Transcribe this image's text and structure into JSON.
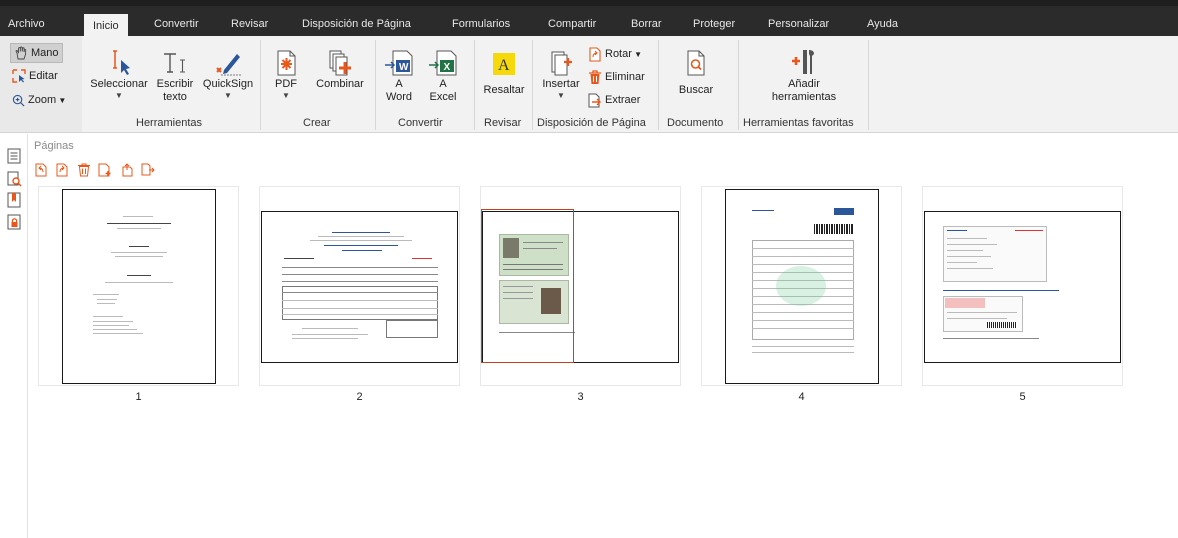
{
  "menu_tabs": [
    {
      "label": "Archivo"
    },
    {
      "label": "Inicio"
    },
    {
      "label": "Convertir"
    },
    {
      "label": "Revisar"
    },
    {
      "label": "Disposición de Página"
    },
    {
      "label": "Formularios"
    },
    {
      "label": "Compartir"
    },
    {
      "label": "Borrar"
    },
    {
      "label": "Proteger"
    },
    {
      "label": "Personalizar"
    },
    {
      "label": "Ayuda"
    }
  ],
  "active_tab": "Inicio",
  "mini_tools": {
    "mano": "Mano",
    "editar": "Editar",
    "zoom": "Zoom"
  },
  "herramientas": {
    "seleccionar": "Seleccionar",
    "escribir_1": "Escribir",
    "escribir_2": "texto",
    "quicksign": "QuickSign",
    "group": "Herramientas"
  },
  "crear": {
    "pdf": "PDF",
    "combinar": "Combinar",
    "group": "Crear"
  },
  "convertir": {
    "a1": "A",
    "word": "Word",
    "a2": "A",
    "excel": "Excel",
    "group": "Convertir"
  },
  "revisar": {
    "resaltar": "Resaltar",
    "group": "Revisar"
  },
  "disposicion": {
    "insertar": "Insertar",
    "rotar": "Rotar",
    "eliminar": "Eliminar",
    "extraer": "Extraer",
    "group": "Disposición de Página"
  },
  "documento": {
    "buscar": "Buscar",
    "group": "Documento"
  },
  "favoritas": {
    "anadir_1": "Añadir",
    "anadir_2": "herramientas",
    "group": "Herramientas favoritas"
  },
  "panel_title": "Páginas",
  "pages": [
    {
      "number": "1"
    },
    {
      "number": "2"
    },
    {
      "number": "3"
    },
    {
      "number": "4"
    },
    {
      "number": "5"
    }
  ],
  "colors": {
    "accent_orange": "#e8581c",
    "tab_bar": "#2b2b2b",
    "ribbon_bg": "#f2f2f2",
    "word_blue": "#2b579a",
    "excel_green": "#217346",
    "highlight_yellow": "#f5d90a"
  },
  "icons": [
    "hand-icon",
    "edit-icon",
    "zoom-icon",
    "select-cursor-icon",
    "type-text-icon",
    "quicksign-pen-icon",
    "pdf-create-icon",
    "combine-icon",
    "to-word-icon",
    "to-excel-icon",
    "highlight-icon",
    "insert-page-icon",
    "rotate-icon",
    "delete-icon",
    "extract-icon",
    "search-doc-icon",
    "add-tools-icon"
  ]
}
